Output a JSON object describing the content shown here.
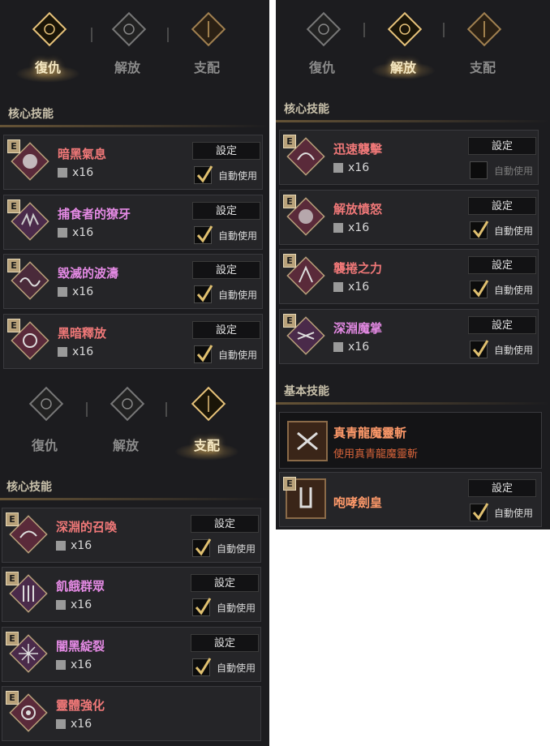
{
  "tab_labels": [
    "復仇",
    "解放",
    "支配"
  ],
  "labels": {
    "core_skills": "核心技能",
    "basic_skills": "基本技能",
    "settings": "設定",
    "auto_use": "自動使用",
    "badge": "E"
  },
  "colors": {
    "accent_gold": "#d4b06a",
    "name_red": "#f07878",
    "name_pink": "#e48ae4",
    "name_orange": "#ff9a6a"
  },
  "panels": {
    "revenge": {
      "active_tab": "復仇",
      "section": "核心技能",
      "skills": [
        {
          "name": "暗黑氣息",
          "count": "x16",
          "auto": true,
          "color": "red"
        },
        {
          "name": "捕食者的獠牙",
          "count": "x16",
          "auto": true,
          "color": "pink"
        },
        {
          "name": "毀滅的波濤",
          "count": "x16",
          "auto": true,
          "color": "pink"
        },
        {
          "name": "黑暗釋放",
          "count": "x16",
          "auto": true,
          "color": "red"
        }
      ]
    },
    "liberation": {
      "active_tab": "解放",
      "section": "核心技能",
      "skills": [
        {
          "name": "迅速襲擊",
          "count": "x16",
          "auto": false,
          "color": "red"
        },
        {
          "name": "解放憤怒",
          "count": "x16",
          "auto": true,
          "color": "red"
        },
        {
          "name": "襲捲之力",
          "count": "x16",
          "auto": true,
          "color": "red"
        },
        {
          "name": "深淵魔掌",
          "count": "x16",
          "auto": true,
          "color": "pink"
        }
      ],
      "basic_section": "基本技能",
      "basic_skills": [
        {
          "name": "真青龍魔靈斬",
          "desc": "使用真青龍魔靈斬"
        },
        {
          "name": "咆哮劍皇",
          "auto": true
        }
      ]
    },
    "domination": {
      "active_tab": "支配",
      "section": "核心技能",
      "skills": [
        {
          "name": "深淵的召喚",
          "count": "x16",
          "auto": true,
          "color": "red"
        },
        {
          "name": "飢餓群眾",
          "count": "x16",
          "auto": true,
          "color": "pink"
        },
        {
          "name": "闇黑綻裂",
          "count": "x16",
          "auto": true,
          "color": "pink"
        },
        {
          "name": "靈體強化",
          "count": "x16",
          "color": "red"
        }
      ]
    }
  }
}
